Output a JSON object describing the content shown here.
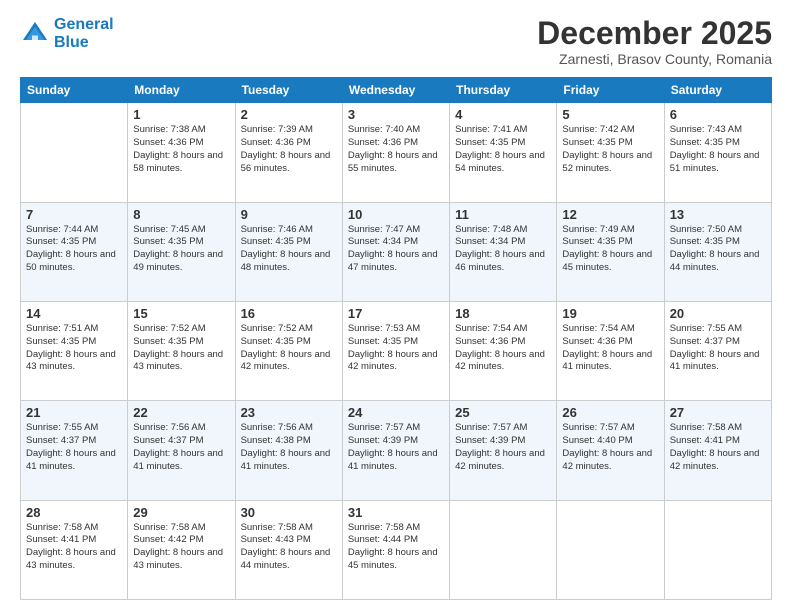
{
  "header": {
    "logo_line1": "General",
    "logo_line2": "Blue",
    "month_title": "December 2025",
    "subtitle": "Zarnesti, Brasov County, Romania"
  },
  "days_of_week": [
    "Sunday",
    "Monday",
    "Tuesday",
    "Wednesday",
    "Thursday",
    "Friday",
    "Saturday"
  ],
  "weeks": [
    [
      {
        "day": "",
        "sunrise": "",
        "sunset": "",
        "daylight": ""
      },
      {
        "day": "1",
        "sunrise": "Sunrise: 7:38 AM",
        "sunset": "Sunset: 4:36 PM",
        "daylight": "Daylight: 8 hours and 58 minutes."
      },
      {
        "day": "2",
        "sunrise": "Sunrise: 7:39 AM",
        "sunset": "Sunset: 4:36 PM",
        "daylight": "Daylight: 8 hours and 56 minutes."
      },
      {
        "day": "3",
        "sunrise": "Sunrise: 7:40 AM",
        "sunset": "Sunset: 4:36 PM",
        "daylight": "Daylight: 8 hours and 55 minutes."
      },
      {
        "day": "4",
        "sunrise": "Sunrise: 7:41 AM",
        "sunset": "Sunset: 4:35 PM",
        "daylight": "Daylight: 8 hours and 54 minutes."
      },
      {
        "day": "5",
        "sunrise": "Sunrise: 7:42 AM",
        "sunset": "Sunset: 4:35 PM",
        "daylight": "Daylight: 8 hours and 52 minutes."
      },
      {
        "day": "6",
        "sunrise": "Sunrise: 7:43 AM",
        "sunset": "Sunset: 4:35 PM",
        "daylight": "Daylight: 8 hours and 51 minutes."
      }
    ],
    [
      {
        "day": "7",
        "sunrise": "Sunrise: 7:44 AM",
        "sunset": "Sunset: 4:35 PM",
        "daylight": "Daylight: 8 hours and 50 minutes."
      },
      {
        "day": "8",
        "sunrise": "Sunrise: 7:45 AM",
        "sunset": "Sunset: 4:35 PM",
        "daylight": "Daylight: 8 hours and 49 minutes."
      },
      {
        "day": "9",
        "sunrise": "Sunrise: 7:46 AM",
        "sunset": "Sunset: 4:35 PM",
        "daylight": "Daylight: 8 hours and 48 minutes."
      },
      {
        "day": "10",
        "sunrise": "Sunrise: 7:47 AM",
        "sunset": "Sunset: 4:34 PM",
        "daylight": "Daylight: 8 hours and 47 minutes."
      },
      {
        "day": "11",
        "sunrise": "Sunrise: 7:48 AM",
        "sunset": "Sunset: 4:34 PM",
        "daylight": "Daylight: 8 hours and 46 minutes."
      },
      {
        "day": "12",
        "sunrise": "Sunrise: 7:49 AM",
        "sunset": "Sunset: 4:35 PM",
        "daylight": "Daylight: 8 hours and 45 minutes."
      },
      {
        "day": "13",
        "sunrise": "Sunrise: 7:50 AM",
        "sunset": "Sunset: 4:35 PM",
        "daylight": "Daylight: 8 hours and 44 minutes."
      }
    ],
    [
      {
        "day": "14",
        "sunrise": "Sunrise: 7:51 AM",
        "sunset": "Sunset: 4:35 PM",
        "daylight": "Daylight: 8 hours and 43 minutes."
      },
      {
        "day": "15",
        "sunrise": "Sunrise: 7:52 AM",
        "sunset": "Sunset: 4:35 PM",
        "daylight": "Daylight: 8 hours and 43 minutes."
      },
      {
        "day": "16",
        "sunrise": "Sunrise: 7:52 AM",
        "sunset": "Sunset: 4:35 PM",
        "daylight": "Daylight: 8 hours and 42 minutes."
      },
      {
        "day": "17",
        "sunrise": "Sunrise: 7:53 AM",
        "sunset": "Sunset: 4:35 PM",
        "daylight": "Daylight: 8 hours and 42 minutes."
      },
      {
        "day": "18",
        "sunrise": "Sunrise: 7:54 AM",
        "sunset": "Sunset: 4:36 PM",
        "daylight": "Daylight: 8 hours and 42 minutes."
      },
      {
        "day": "19",
        "sunrise": "Sunrise: 7:54 AM",
        "sunset": "Sunset: 4:36 PM",
        "daylight": "Daylight: 8 hours and 41 minutes."
      },
      {
        "day": "20",
        "sunrise": "Sunrise: 7:55 AM",
        "sunset": "Sunset: 4:37 PM",
        "daylight": "Daylight: 8 hours and 41 minutes."
      }
    ],
    [
      {
        "day": "21",
        "sunrise": "Sunrise: 7:55 AM",
        "sunset": "Sunset: 4:37 PM",
        "daylight": "Daylight: 8 hours and 41 minutes."
      },
      {
        "day": "22",
        "sunrise": "Sunrise: 7:56 AM",
        "sunset": "Sunset: 4:37 PM",
        "daylight": "Daylight: 8 hours and 41 minutes."
      },
      {
        "day": "23",
        "sunrise": "Sunrise: 7:56 AM",
        "sunset": "Sunset: 4:38 PM",
        "daylight": "Daylight: 8 hours and 41 minutes."
      },
      {
        "day": "24",
        "sunrise": "Sunrise: 7:57 AM",
        "sunset": "Sunset: 4:39 PM",
        "daylight": "Daylight: 8 hours and 41 minutes."
      },
      {
        "day": "25",
        "sunrise": "Sunrise: 7:57 AM",
        "sunset": "Sunset: 4:39 PM",
        "daylight": "Daylight: 8 hours and 42 minutes."
      },
      {
        "day": "26",
        "sunrise": "Sunrise: 7:57 AM",
        "sunset": "Sunset: 4:40 PM",
        "daylight": "Daylight: 8 hours and 42 minutes."
      },
      {
        "day": "27",
        "sunrise": "Sunrise: 7:58 AM",
        "sunset": "Sunset: 4:41 PM",
        "daylight": "Daylight: 8 hours and 42 minutes."
      }
    ],
    [
      {
        "day": "28",
        "sunrise": "Sunrise: 7:58 AM",
        "sunset": "Sunset: 4:41 PM",
        "daylight": "Daylight: 8 hours and 43 minutes."
      },
      {
        "day": "29",
        "sunrise": "Sunrise: 7:58 AM",
        "sunset": "Sunset: 4:42 PM",
        "daylight": "Daylight: 8 hours and 43 minutes."
      },
      {
        "day": "30",
        "sunrise": "Sunrise: 7:58 AM",
        "sunset": "Sunset: 4:43 PM",
        "daylight": "Daylight: 8 hours and 44 minutes."
      },
      {
        "day": "31",
        "sunrise": "Sunrise: 7:58 AM",
        "sunset": "Sunset: 4:44 PM",
        "daylight": "Daylight: 8 hours and 45 minutes."
      },
      {
        "day": "",
        "sunrise": "",
        "sunset": "",
        "daylight": ""
      },
      {
        "day": "",
        "sunrise": "",
        "sunset": "",
        "daylight": ""
      },
      {
        "day": "",
        "sunrise": "",
        "sunset": "",
        "daylight": ""
      }
    ]
  ]
}
